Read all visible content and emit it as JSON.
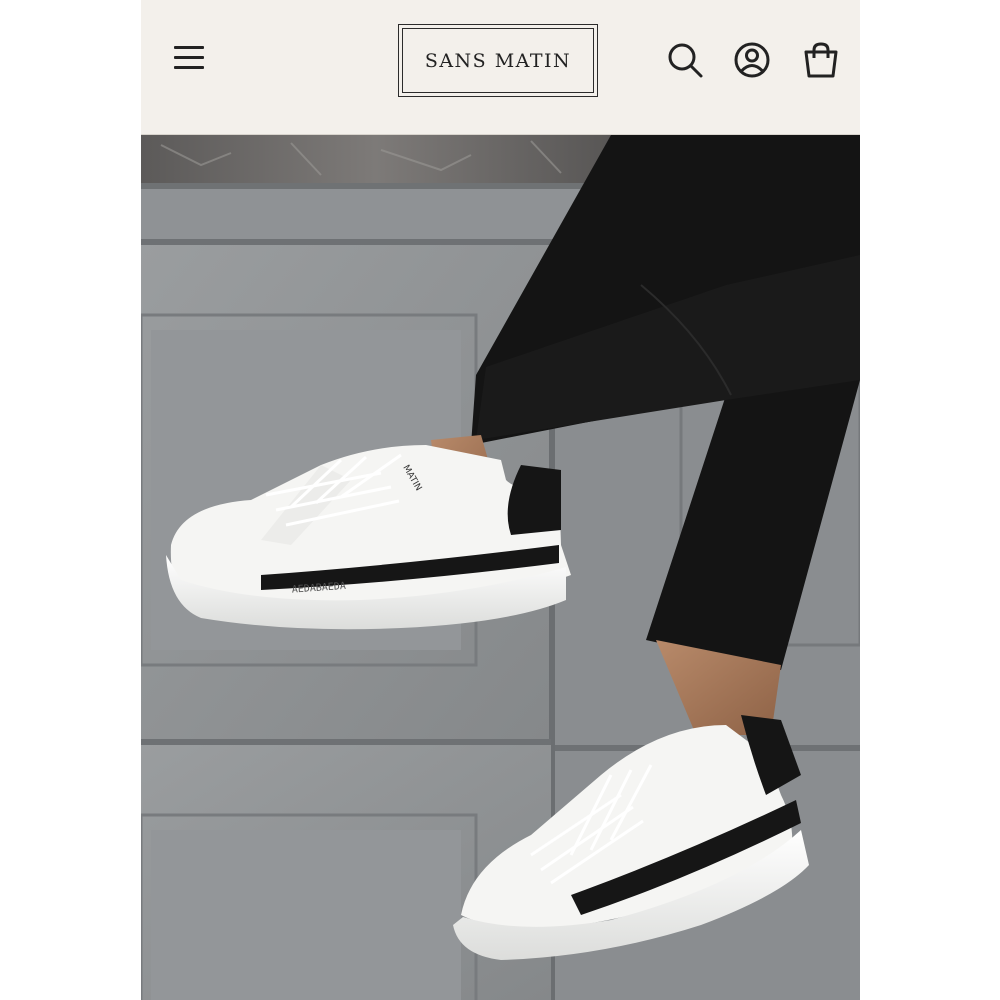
{
  "header": {
    "brand": "SANS MATIN",
    "menu_icon": "hamburger-menu-icon",
    "search_icon": "search-icon",
    "account_icon": "account-icon",
    "cart_icon": "shopping-bag-icon"
  },
  "hero": {
    "image_description_icon": "product-photo",
    "shoe_tongue_text": "MATIN",
    "stripe_text": "AEDABAEDA"
  },
  "colors": {
    "header_bg": "#f3f0eb",
    "cabinet_gray": "#8e9194",
    "marble": "#6a6867",
    "jeans": "#121212",
    "sneaker_white": "#f4f4f2",
    "stripe_black": "#161616"
  }
}
